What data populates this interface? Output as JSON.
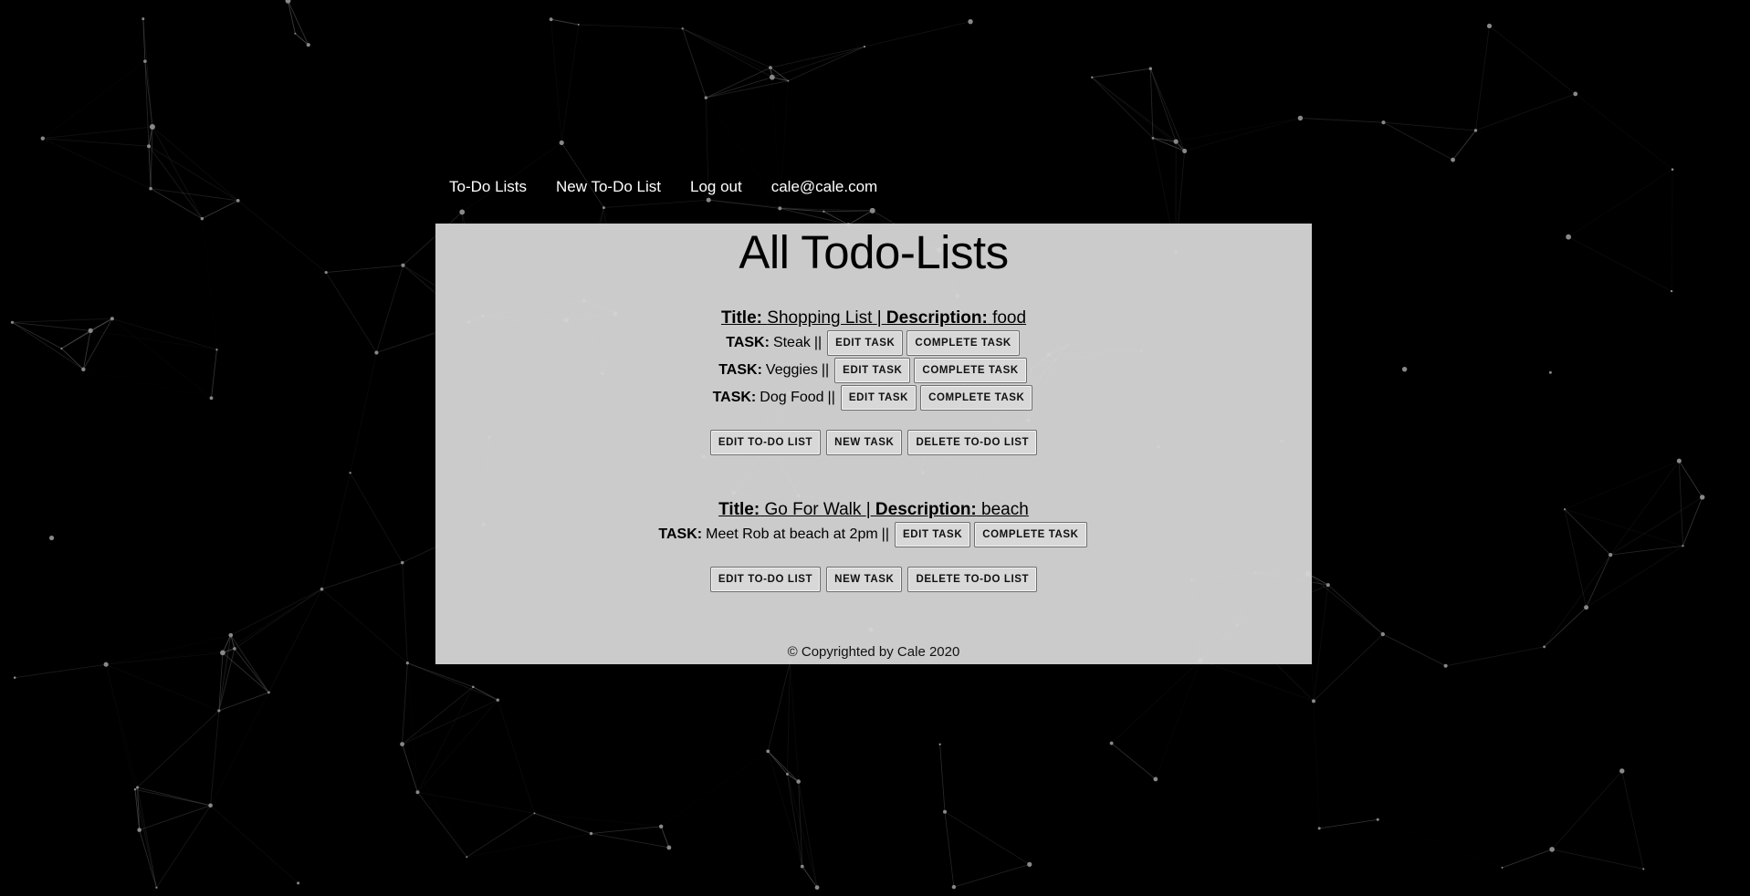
{
  "nav": {
    "items": [
      "To-Do Lists",
      "New To-Do List",
      "Log out",
      "cale@cale.com"
    ]
  },
  "page_title": "All Todo-Lists",
  "labels": {
    "title": "Title:",
    "description": "Description:",
    "task": "TASK:",
    "separator": "|",
    "task_separator": "||"
  },
  "buttons": {
    "edit_task": "EDIT TASK",
    "complete_task": "COMPLETE TASK",
    "edit_list": "EDIT TO-DO LIST",
    "new_task": "NEW TASK",
    "delete_list": "DELETE TO-DO LIST"
  },
  "lists": [
    {
      "title": "Shopping List",
      "description": "food",
      "tasks": [
        "Steak",
        "Veggies",
        "Dog Food"
      ]
    },
    {
      "title": "Go For Walk",
      "description": "beach",
      "tasks": [
        "Meet Rob at beach at 2pm"
      ]
    }
  ],
  "footer": "© Copyrighted by Cale 2020",
  "colors": {
    "background": "#000000",
    "panel": "#d6d6d6",
    "nav_text": "#ffffff",
    "network_lines": "#555555"
  }
}
